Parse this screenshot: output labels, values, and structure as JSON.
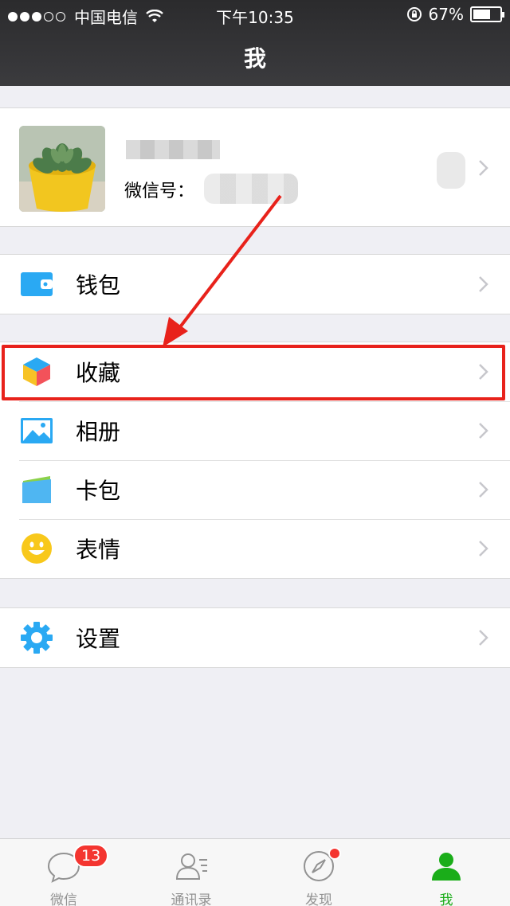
{
  "status_bar": {
    "carrier": "中国电信",
    "time": "下午10:35",
    "battery_text": "67%",
    "battery_level": 0.67
  },
  "header": {
    "title": "我"
  },
  "profile": {
    "wechat_id_label": "微信号："
  },
  "menu": {
    "wallet": "钱包",
    "favorites": "收藏",
    "album": "相册",
    "card_wallet": "卡包",
    "stickers": "表情",
    "settings": "设置"
  },
  "tabbar": {
    "items": [
      {
        "label": "微信",
        "icon": "chat-icon",
        "badge": "13"
      },
      {
        "label": "通讯录",
        "icon": "contacts-icon"
      },
      {
        "label": "发现",
        "icon": "compass-icon",
        "dot": true
      },
      {
        "label": "我",
        "icon": "person-icon",
        "active": true
      }
    ]
  },
  "colors": {
    "accent_green": "#1aad19",
    "badge_red": "#f43530",
    "highlight_red": "#e8221b",
    "icon_blue": "#2aa9f3"
  }
}
